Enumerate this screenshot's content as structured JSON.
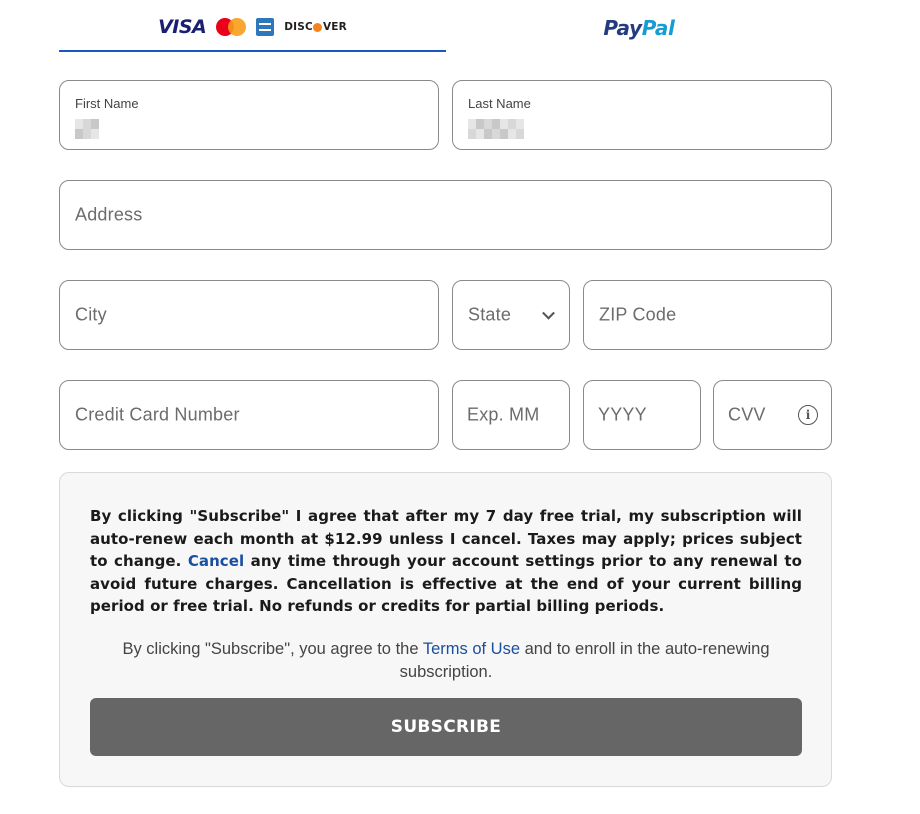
{
  "tabs": {
    "card": {
      "visa": "VISA",
      "discover_pre": "DISC",
      "discover_post": "VER"
    },
    "paypal": {
      "pay": "Pay",
      "pal": "Pal"
    }
  },
  "form": {
    "first_name": {
      "label": "First Name"
    },
    "last_name": {
      "label": "Last Name"
    },
    "address": {
      "placeholder": "Address"
    },
    "city": {
      "placeholder": "City"
    },
    "state": {
      "placeholder": "State"
    },
    "zip": {
      "placeholder": "ZIP Code"
    },
    "card_number": {
      "placeholder": "Credit Card Number"
    },
    "exp_month": {
      "placeholder": "Exp. MM"
    },
    "exp_year": {
      "placeholder": "YYYY"
    },
    "cvv": {
      "placeholder": "CVV"
    }
  },
  "terms": {
    "main_before_link": "By clicking \"Subscribe\" I agree that after my 7 day free trial, my subscription will auto-renew each month at $12.99 unless I cancel. Taxes may apply; prices subject to change.",
    "cancel_link": "Cancel",
    "main_after_link": "any time through your account settings prior to any renewal to avoid future charges. Cancellation is effective at the end of your current billing period or free trial. No refunds or credits for partial billing periods.",
    "sub_before_link": "By clicking \"Subscribe\", you agree to the",
    "terms_link": "Terms of Use",
    "sub_after_link": "and to enroll in the auto-renewing subscription."
  },
  "subscribe_button": "SUBSCRIBE",
  "colors": {
    "tab_underline": "#1a56c4",
    "link": "#1a4fa0",
    "button_bg": "#666666",
    "field_border": "#8a8a8a",
    "terms_bg": "#f7f7f7"
  }
}
